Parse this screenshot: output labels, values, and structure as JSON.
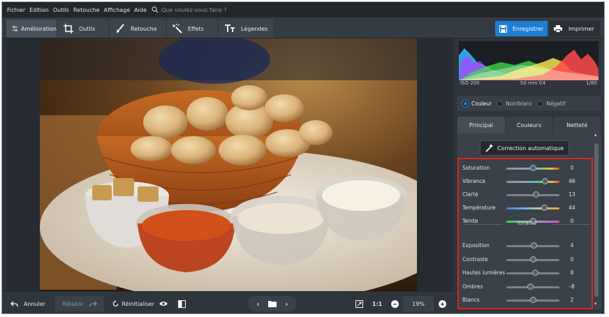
{
  "menu": {
    "items": [
      "Fichier",
      "Edition",
      "Outils",
      "Retouche",
      "Affichage",
      "Aide"
    ],
    "search_placeholder": "Que voulez-vous faire ?"
  },
  "tabs": [
    {
      "label": "Amélioration",
      "icon": "sliders-icon"
    },
    {
      "label": "Outils",
      "icon": "crop-icon"
    },
    {
      "label": "Retouche",
      "icon": "brush-icon"
    },
    {
      "label": "Effets",
      "icon": "magic-wand-icon"
    },
    {
      "label": "Légendes",
      "icon": "text-icon"
    }
  ],
  "actions": {
    "save": "Enregistrer",
    "print": "Imprimer"
  },
  "exif": {
    "iso": "ISO 200",
    "lens": "50 mm f/4",
    "shutter": "1/60"
  },
  "modes": {
    "color": "Couleur",
    "bw": "Noir/blanc",
    "negative": "Négatif",
    "selected": "Couleur"
  },
  "subtabs": {
    "main": "Principal",
    "colors": "Couleurs",
    "sharpness": "Netteté",
    "active": "Principal"
  },
  "auto_correct": "Correction automatique",
  "sliders_color": [
    {
      "label": "Saturation",
      "value": "0",
      "level": 0.5,
      "track": "rainbow"
    },
    {
      "label": "Vibrance",
      "value": "46",
      "level": 0.73,
      "track": "rainbow"
    },
    {
      "label": "Clarté",
      "value": "13",
      "level": 0.56,
      "track": "gray"
    },
    {
      "label": "Température",
      "value": "44",
      "level": 0.72,
      "track": "temp"
    },
    {
      "label": "Teinte",
      "value": "0",
      "level": 0.5,
      "track": "tint"
    }
  ],
  "tonality_title": "Tonalité",
  "sliders_tone": [
    {
      "label": "Exposition",
      "value": "4",
      "level": 0.52,
      "track": "gray"
    },
    {
      "label": "Contraste",
      "value": "0",
      "level": 0.5,
      "track": "gray"
    },
    {
      "label": "Hautes lumières",
      "value": "8",
      "level": 0.54,
      "track": "gray"
    },
    {
      "label": "Ombres",
      "value": "-8",
      "level": 0.46,
      "track": "gray"
    },
    {
      "label": "Blancs",
      "value": "2",
      "level": 0.51,
      "track": "gray"
    }
  ],
  "bottom": {
    "undo": "Annuler",
    "redo": "Rétablir",
    "reset": "Réinitialiser",
    "ratio": "1:1",
    "zoom": "19%"
  },
  "colors": {
    "accent": "#1e7ed6",
    "highlight_box": "#e52321"
  }
}
